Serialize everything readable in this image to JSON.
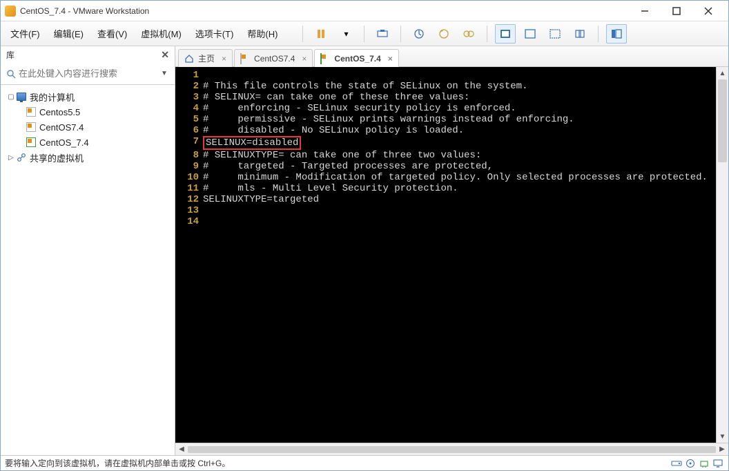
{
  "window": {
    "title": "CentOS_7.4 - VMware Workstation"
  },
  "menu": {
    "file": "文件(F)",
    "edit": "编辑(E)",
    "view": "查看(V)",
    "vm": "虚拟机(M)",
    "tabs": "选项卡(T)",
    "help": "帮助(H)"
  },
  "sidebar": {
    "title": "库",
    "search_placeholder": "在此处键入内容进行搜索",
    "nodes": {
      "my_computer": "我的计算机",
      "centos55": "Centos5.5",
      "centos74": "CentOS7.4",
      "centos_74": "CentOS_7.4",
      "shared": "共享的虚拟机"
    }
  },
  "tabs": {
    "home": "主页",
    "t1": "CentOS7.4",
    "t2": "CentOS_7.4"
  },
  "terminal": {
    "lines": [
      "",
      "# This file controls the state of SELinux on the system.",
      "# SELINUX= can take one of these three values:",
      "#     enforcing - SELinux security policy is enforced.",
      "#     permissive - SELinux prints warnings instead of enforcing.",
      "#     disabled - No SELinux policy is loaded.",
      "SELINUX=disabled",
      "# SELINUXTYPE= can take one of three two values:",
      "#     targeted - Targeted processes are protected,",
      "#     minimum - Modification of targeted policy. Only selected processes are protected.",
      "#     mls - Multi Level Security protection.",
      "SELINUXTYPE=targeted",
      "",
      ""
    ],
    "highlight_line": 7
  },
  "statusbar": {
    "hint": "要将输入定向到该虚拟机，请在虚拟机内部单击或按 Ctrl+G。"
  }
}
